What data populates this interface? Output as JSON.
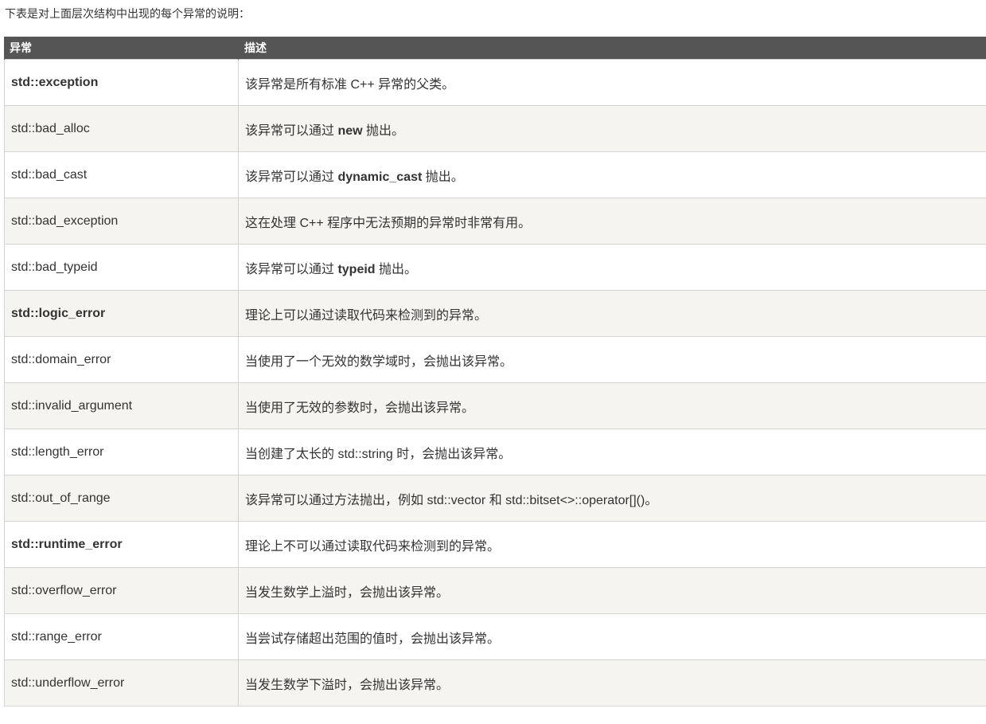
{
  "intro": "下表是对上面层次结构中出现的每个异常的说明：",
  "table": {
    "headers": [
      "异常",
      "描述"
    ],
    "rows": [
      {
        "name": "std::exception",
        "bold": true,
        "desc_pre": "该异常是所有标准 C++ 异常的父类。",
        "desc_kw": "",
        "desc_post": ""
      },
      {
        "name": "std::bad_alloc",
        "bold": false,
        "desc_pre": "该异常可以通过 ",
        "desc_kw": "new",
        "desc_post": " 抛出。"
      },
      {
        "name": "std::bad_cast",
        "bold": false,
        "desc_pre": "该异常可以通过 ",
        "desc_kw": "dynamic_cast",
        "desc_post": " 抛出。"
      },
      {
        "name": "std::bad_exception",
        "bold": false,
        "desc_pre": "这在处理 C++ 程序中无法预期的异常时非常有用。",
        "desc_kw": "",
        "desc_post": ""
      },
      {
        "name": "std::bad_typeid",
        "bold": false,
        "desc_pre": "该异常可以通过 ",
        "desc_kw": "typeid",
        "desc_post": " 抛出。"
      },
      {
        "name": "std::logic_error",
        "bold": true,
        "desc_pre": "理论上可以通过读取代码来检测到的异常。",
        "desc_kw": "",
        "desc_post": ""
      },
      {
        "name": "std::domain_error",
        "bold": false,
        "desc_pre": "当使用了一个无效的数学域时，会抛出该异常。",
        "desc_kw": "",
        "desc_post": ""
      },
      {
        "name": "std::invalid_argument",
        "bold": false,
        "desc_pre": "当使用了无效的参数时，会抛出该异常。",
        "desc_kw": "",
        "desc_post": ""
      },
      {
        "name": "std::length_error",
        "bold": false,
        "desc_pre": "当创建了太长的 std::string 时，会抛出该异常。",
        "desc_kw": "",
        "desc_post": ""
      },
      {
        "name": "std::out_of_range",
        "bold": false,
        "desc_pre": "该异常可以通过方法抛出，例如 std::vector 和 std::bitset<>::operator[]()。",
        "desc_kw": "",
        "desc_post": ""
      },
      {
        "name": "std::runtime_error",
        "bold": true,
        "desc_pre": "理论上不可以通过读取代码来检测到的异常。",
        "desc_kw": "",
        "desc_post": ""
      },
      {
        "name": "std::overflow_error",
        "bold": false,
        "desc_pre": "当发生数学上溢时，会抛出该异常。",
        "desc_kw": "",
        "desc_post": ""
      },
      {
        "name": "std::range_error",
        "bold": false,
        "desc_pre": "当尝试存储超出范围的值时，会抛出该异常。",
        "desc_kw": "",
        "desc_post": ""
      },
      {
        "name": "std::underflow_error",
        "bold": false,
        "desc_pre": "当发生数学下溢时，会抛出该异常。",
        "desc_kw": "",
        "desc_post": ""
      }
    ]
  },
  "colors": {
    "header_bg": "#555555",
    "header_text": "#ffffff",
    "row_alt_bg": "#f6f4f0",
    "row_bg": "#ffffff",
    "border": "#d4d4d4",
    "text": "#333333"
  }
}
